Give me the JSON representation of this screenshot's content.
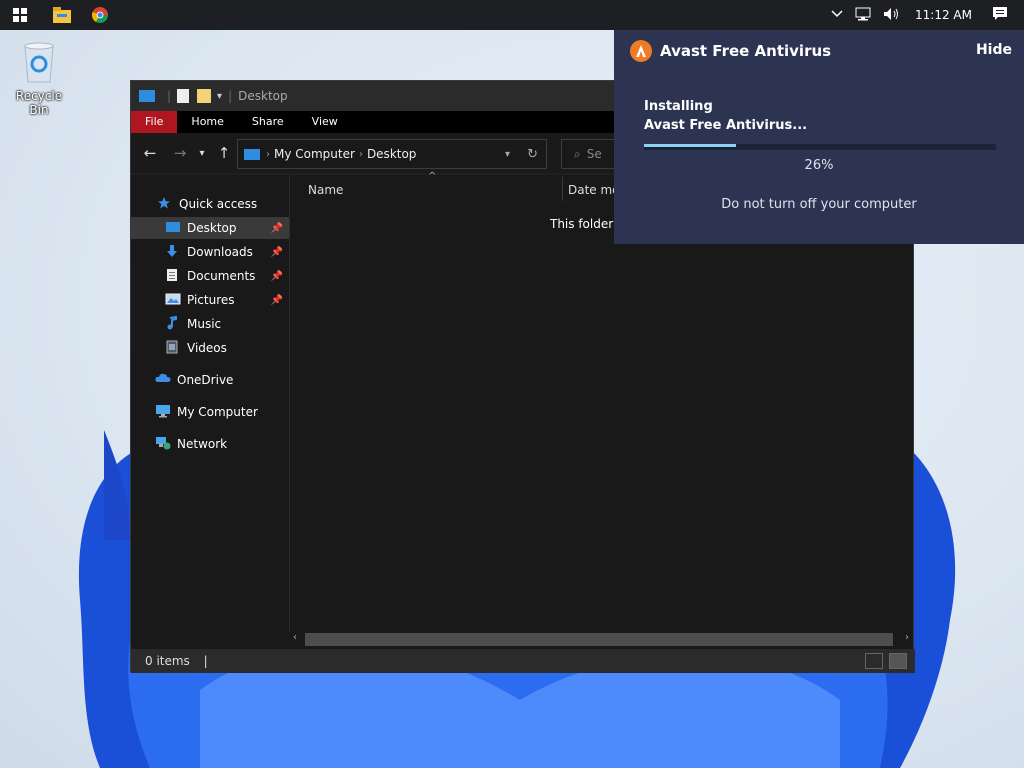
{
  "taskbar": {
    "time": "11:12 AM",
    "icons": [
      "windows-start-icon",
      "file-explorer-icon",
      "chrome-icon"
    ],
    "tray_icons": [
      "chevron-up-icon",
      "network-icon",
      "volume-icon",
      "notifications-icon"
    ]
  },
  "desktop": {
    "recycle_bin_label": "Recycle Bin"
  },
  "explorer": {
    "title": "Desktop",
    "ribbon_tabs": [
      "File",
      "Home",
      "Share",
      "View"
    ],
    "address": {
      "root": "My Computer",
      "current": "Desktop"
    },
    "search_placeholder": "Se",
    "nav": {
      "quick_access": "Quick access",
      "items": [
        {
          "label": "Desktop",
          "icon": "desktop-icon",
          "pinned": true
        },
        {
          "label": "Downloads",
          "icon": "downloads-icon",
          "pinned": true
        },
        {
          "label": "Documents",
          "icon": "documents-icon",
          "pinned": true
        },
        {
          "label": "Pictures",
          "icon": "pictures-icon",
          "pinned": true
        },
        {
          "label": "Music",
          "icon": "music-icon",
          "pinned": false
        },
        {
          "label": "Videos",
          "icon": "videos-icon",
          "pinned": false
        }
      ],
      "onedrive": "OneDrive",
      "my_computer": "My Computer",
      "network": "Network"
    },
    "columns": {
      "name": "Name",
      "date": "Date mo"
    },
    "empty_message": "This folder is",
    "status_text": "0 items"
  },
  "avast": {
    "title": "Avast Free Antivirus",
    "hide_label": "Hide",
    "installing_line1": "Installing",
    "installing_line2": "Avast Free Antivirus...",
    "progress": 0.26,
    "progress_label": "26%",
    "note": "Do not turn off your computer",
    "accent": "#f07b24",
    "bg": "#2c3452"
  }
}
